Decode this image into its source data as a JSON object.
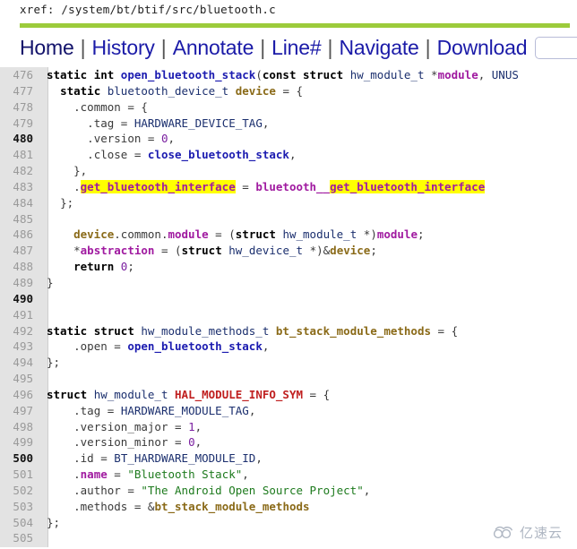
{
  "header": {
    "xref_label": "xref:",
    "xref_path": "/system/bt/btif/src/bluetooth.c",
    "accent_bar_color": "#9ccb3b"
  },
  "nav": {
    "items": [
      {
        "label": "Home"
      },
      {
        "label": "History"
      },
      {
        "label": "Annotate"
      },
      {
        "label": "Line#"
      },
      {
        "label": "Navigate"
      },
      {
        "label": "Download"
      }
    ],
    "separator": "|",
    "search": {
      "value": "",
      "placeholder": ""
    }
  },
  "code": {
    "language": "c",
    "first_line": 476,
    "last_line": 505,
    "lines": [
      {
        "no": "476",
        "text": "static int open_bluetooth_stack(const struct hw_module_t *module, UNUS"
      },
      {
        "no": "477",
        "text": "  static bluetooth_device_t device = {"
      },
      {
        "no": "478",
        "text": "    .common = {"
      },
      {
        "no": "479",
        "text": "      .tag = HARDWARE_DEVICE_TAG,"
      },
      {
        "no": "480",
        "text": "      .version = 0,"
      },
      {
        "no": "481",
        "text": "      .close = close_bluetooth_stack,"
      },
      {
        "no": "482",
        "text": "    },"
      },
      {
        "no": "483",
        "text": "    .get_bluetooth_interface = bluetooth__get_bluetooth_interface"
      },
      {
        "no": "484",
        "text": "  };"
      },
      {
        "no": "485",
        "text": ""
      },
      {
        "no": "486",
        "text": "    device.common.module = (struct hw_module_t *)module;"
      },
      {
        "no": "487",
        "text": "    *abstraction = (struct hw_device_t *)&device;"
      },
      {
        "no": "488",
        "text": "    return 0;"
      },
      {
        "no": "489",
        "text": "}"
      },
      {
        "no": "490",
        "text": ""
      },
      {
        "no": "491",
        "text": ""
      },
      {
        "no": "492",
        "text": "static struct hw_module_methods_t bt_stack_module_methods = {"
      },
      {
        "no": "493",
        "text": "    .open = open_bluetooth_stack,"
      },
      {
        "no": "494",
        "text": "};"
      },
      {
        "no": "495",
        "text": ""
      },
      {
        "no": "496",
        "text": "struct hw_module_t HAL_MODULE_INFO_SYM = {"
      },
      {
        "no": "497",
        "text": "    .tag = HARDWARE_MODULE_TAG,"
      },
      {
        "no": "498",
        "text": "    .version_major = 1,"
      },
      {
        "no": "499",
        "text": "    .version_minor = 0,"
      },
      {
        "no": "500",
        "text": "    .id = BT_HARDWARE_MODULE_ID,"
      },
      {
        "no": "501",
        "text": "    .name = \"Bluetooth Stack\","
      },
      {
        "no": "502",
        "text": "    .author = \"The Android Open Source Project\","
      },
      {
        "no": "503",
        "text": "    .methods = &bt_stack_module_methods"
      },
      {
        "no": "504",
        "text": "};"
      },
      {
        "no": "505",
        "text": ""
      }
    ],
    "highlighted_terms": [
      "get_bluetooth_interface"
    ],
    "highlight_color": "#ffff00"
  },
  "watermark": {
    "text": "亿速云",
    "icon": "cloud-icon"
  }
}
